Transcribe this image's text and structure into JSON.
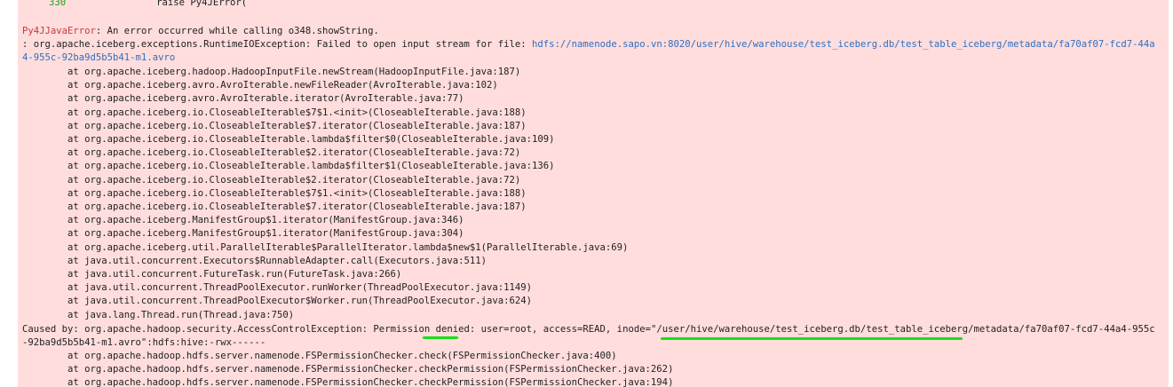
{
  "traceback": {
    "line_number": "330",
    "raise_statement": "raise Py4JError("
  },
  "error_header": {
    "error_type": "Py4JJavaError",
    "message": ": An error occurred while calling o348.showString."
  },
  "exception": {
    "prefix": ": org.apache.iceberg.exceptions.RuntimeIOException: Failed to open input stream for file: ",
    "file_link_part1": "hdfs://namenode.sapo.vn:8020/user/hive/warehouse/test_iceberg.db/test_table_iceberg/metadata/fa70af07-fcd7-44a",
    "file_link_part2": "4-955c-92ba9d5b5b41-m1.avro"
  },
  "stack_frames": [
    "at org.apache.iceberg.hadoop.HadoopInputFile.newStream(HadoopInputFile.java:187)",
    "at org.apache.iceberg.avro.AvroIterable.newFileReader(AvroIterable.java:102)",
    "at org.apache.iceberg.avro.AvroIterable.iterator(AvroIterable.java:77)",
    "at org.apache.iceberg.io.CloseableIterable$7$1.<init>(CloseableIterable.java:188)",
    "at org.apache.iceberg.io.CloseableIterable$7.iterator(CloseableIterable.java:187)",
    "at org.apache.iceberg.io.CloseableIterable.lambda$filter$0(CloseableIterable.java:109)",
    "at org.apache.iceberg.io.CloseableIterable$2.iterator(CloseableIterable.java:72)",
    "at org.apache.iceberg.io.CloseableIterable.lambda$filter$1(CloseableIterable.java:136)",
    "at org.apache.iceberg.io.CloseableIterable$2.iterator(CloseableIterable.java:72)",
    "at org.apache.iceberg.io.CloseableIterable$7$1.<init>(CloseableIterable.java:188)",
    "at org.apache.iceberg.io.CloseableIterable$7.iterator(CloseableIterable.java:187)",
    "at org.apache.iceberg.ManifestGroup$1.iterator(ManifestGroup.java:346)",
    "at org.apache.iceberg.ManifestGroup$1.iterator(ManifestGroup.java:304)",
    "at org.apache.iceberg.util.ParallelIterable$ParallelIterator.lambda$new$1(ParallelIterable.java:69)",
    "at java.util.concurrent.Executors$RunnableAdapter.call(Executors.java:511)",
    "at java.util.concurrent.FutureTask.run(FutureTask.java:266)",
    "at java.util.concurrent.ThreadPoolExecutor.runWorker(ThreadPoolExecutor.java:1149)",
    "at java.util.concurrent.ThreadPoolExecutor$Worker.run(ThreadPoolExecutor.java:624)",
    "at java.lang.Thread.run(Thread.java:750)"
  ],
  "caused_by": {
    "line1": "Caused by: org.apache.hadoop.security.AccessControlException: Permission denied: user=root, access=READ, inode=\"/user/hive/warehouse/test_iceberg.db/test_table_iceberg/metadata/fa70af07-fcd7-44a4-955c",
    "line2": "-92ba9d5b5b41-m1.avro\":hdfs:hive:-rwx------"
  },
  "caused_frames": [
    "at org.apache.hadoop.hdfs.server.namenode.FSPermissionChecker.check(FSPermissionChecker.java:400)",
    "at org.apache.hadoop.hdfs.server.namenode.FSPermissionChecker.checkPermission(FSPermissionChecker.java:262)",
    "at org.apache.hadoop.hdfs.server.namenode.FSPermissionChecker.checkPermission(FSPermissionChecker.java:194)"
  ],
  "colors": {
    "panel_background": "#ffdddd",
    "error_type": "#c63a3a",
    "line_number": "#17a217",
    "link": "#2f6fc0",
    "highlight_underline": "#17e017"
  }
}
